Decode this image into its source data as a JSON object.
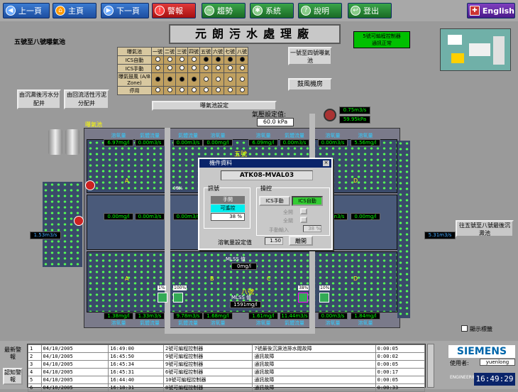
{
  "nav": [
    {
      "label": "上一頁",
      "icon": "arrow-left-icon"
    },
    {
      "label": "主頁",
      "icon": "home-icon"
    },
    {
      "label": "下一頁",
      "icon": "arrow-right-icon"
    },
    {
      "label": "警報",
      "icon": "alarm-icon"
    },
    {
      "label": "趨勢",
      "icon": "trend-icon"
    },
    {
      "label": "系統",
      "icon": "system-icon"
    },
    {
      "label": "說明",
      "icon": "help-icon"
    },
    {
      "label": "登出",
      "icon": "logout-icon"
    }
  ],
  "english_label": "English",
  "page_title": "元朗污水處理廠",
  "plc_status": {
    "line1": "5號可編程控制器",
    "line2": "通訊正常"
  },
  "section_title": "五號至八號曝氣池",
  "control_table": {
    "headers": [
      "曝氣池",
      "一號",
      "二號",
      "三號",
      "四號",
      "五號",
      "六號",
      "七號",
      "八號"
    ],
    "rows": [
      "ICS自動",
      "ICS手動",
      "曝氣鼓風 (A/B Zone)",
      "停用"
    ]
  },
  "aeration_setting_button": "曝氣池設定",
  "blower_room_1_4": "一號至四號曝氣池",
  "blower_room": "鼓風機房",
  "air_pressure_label": "氣壓設定值:",
  "air_pressure_value": "60.0 kPa",
  "flow_top": "0.75m3/s",
  "pressure_top": "59.95kPa",
  "distribution_1": "由沉澱後污水分配井",
  "distribution_2": "由回流活性污泥分配井",
  "aeration_label": "曝氣池",
  "to_next": "往五號至八號最後沉澱池",
  "flow_left": "1.53m3/s",
  "flow_right": "5.31m3/s",
  "basin5_label": "五號",
  "basin8_label": "八號",
  "zones": [
    "A",
    "B",
    "C",
    "D"
  ],
  "do_labels": [
    "溶氧量",
    "氣體流量",
    "氣體流量",
    "溶氧量",
    "溶氧量",
    "氣體流量",
    "溶氧量",
    "溶氧量"
  ],
  "top_values": [
    "6.97mg/l",
    "0.00m3/s",
    "0.00m3/s",
    "0.00mg/l",
    "6.09mg/l",
    "0.00m3/s",
    "0.00m3/s",
    "5.56mg/l"
  ],
  "mid_values": [
    "0.00mg/l",
    "0.00m3/s",
    "0.00m3/s",
    "0.00mg/l",
    "0.00mg/l",
    "0.00m3/s",
    "0.00m3/s",
    "0.00mg/l"
  ],
  "bot_values": [
    "1.38mg/l",
    "1.33m3/s",
    "9.78m3/s",
    "1.68mg/l",
    "1.61mg/l",
    "11.44m3/s",
    "0.00m3/s",
    "1.84mg/l"
  ],
  "mlss_label": "MLSS 值",
  "mlss_5": "0mg/l",
  "mlss_8": "1591mg/l",
  "pct_top": [
    "0%",
    "0%",
    "0%",
    "0%"
  ],
  "pct_bottom": [
    "1%",
    "100%",
    "38%",
    "10%"
  ],
  "dialog": {
    "title": "機件資料",
    "device": "ATK08-MVAL03",
    "status_group": "訊號",
    "manual": "手開",
    "remote": "可遙控",
    "percent": "38 %",
    "control_group": "操控",
    "ics_manual": "ICS手動",
    "ics_auto": "ICS自動",
    "open_all": "全開",
    "close_all": "全關",
    "manual_input": "手動輸入",
    "manual_pct": "38 %",
    "do_setpoint_label": "溶氧量設定值",
    "do_setpoint": "1.50",
    "leave": "離開"
  },
  "show_labels": "顯示標籤",
  "alarm_section": {
    "recent": "最新警報",
    "ack": "認知警報"
  },
  "log_rows": [
    [
      "1",
      "04/10/2005",
      "16:49:00",
      "2號可編程控制器",
      "7號最後沉澱池排水閥故障",
      "0:00:05"
    ],
    [
      "2",
      "04/10/2005",
      "16:45:50",
      "9號可編程控制器",
      "通訊故障",
      "0:00:02"
    ],
    [
      "3",
      "04/10/2005",
      "16:45:34",
      "9號可編程控制器",
      "通訊故障",
      "0:00:05"
    ],
    [
      "4",
      "04/10/2005",
      "16:45:31",
      "6號可編程控制器",
      "通訊故障",
      "0:00:17"
    ],
    [
      "5",
      "04/10/2005",
      "16:44:40",
      "10號可編程控制器",
      "通訊故障",
      "0:00:05"
    ],
    [
      "6",
      "04/10/2005",
      "16:18:31",
      "8號可編程控制器",
      "通訊故障",
      "0:00:33"
    ]
  ],
  "siemens": "SIEMENS",
  "user_label": "使用者:",
  "user_name": "yuenlong",
  "clock": "16:49:29",
  "engineering": "ENGINEERING"
}
